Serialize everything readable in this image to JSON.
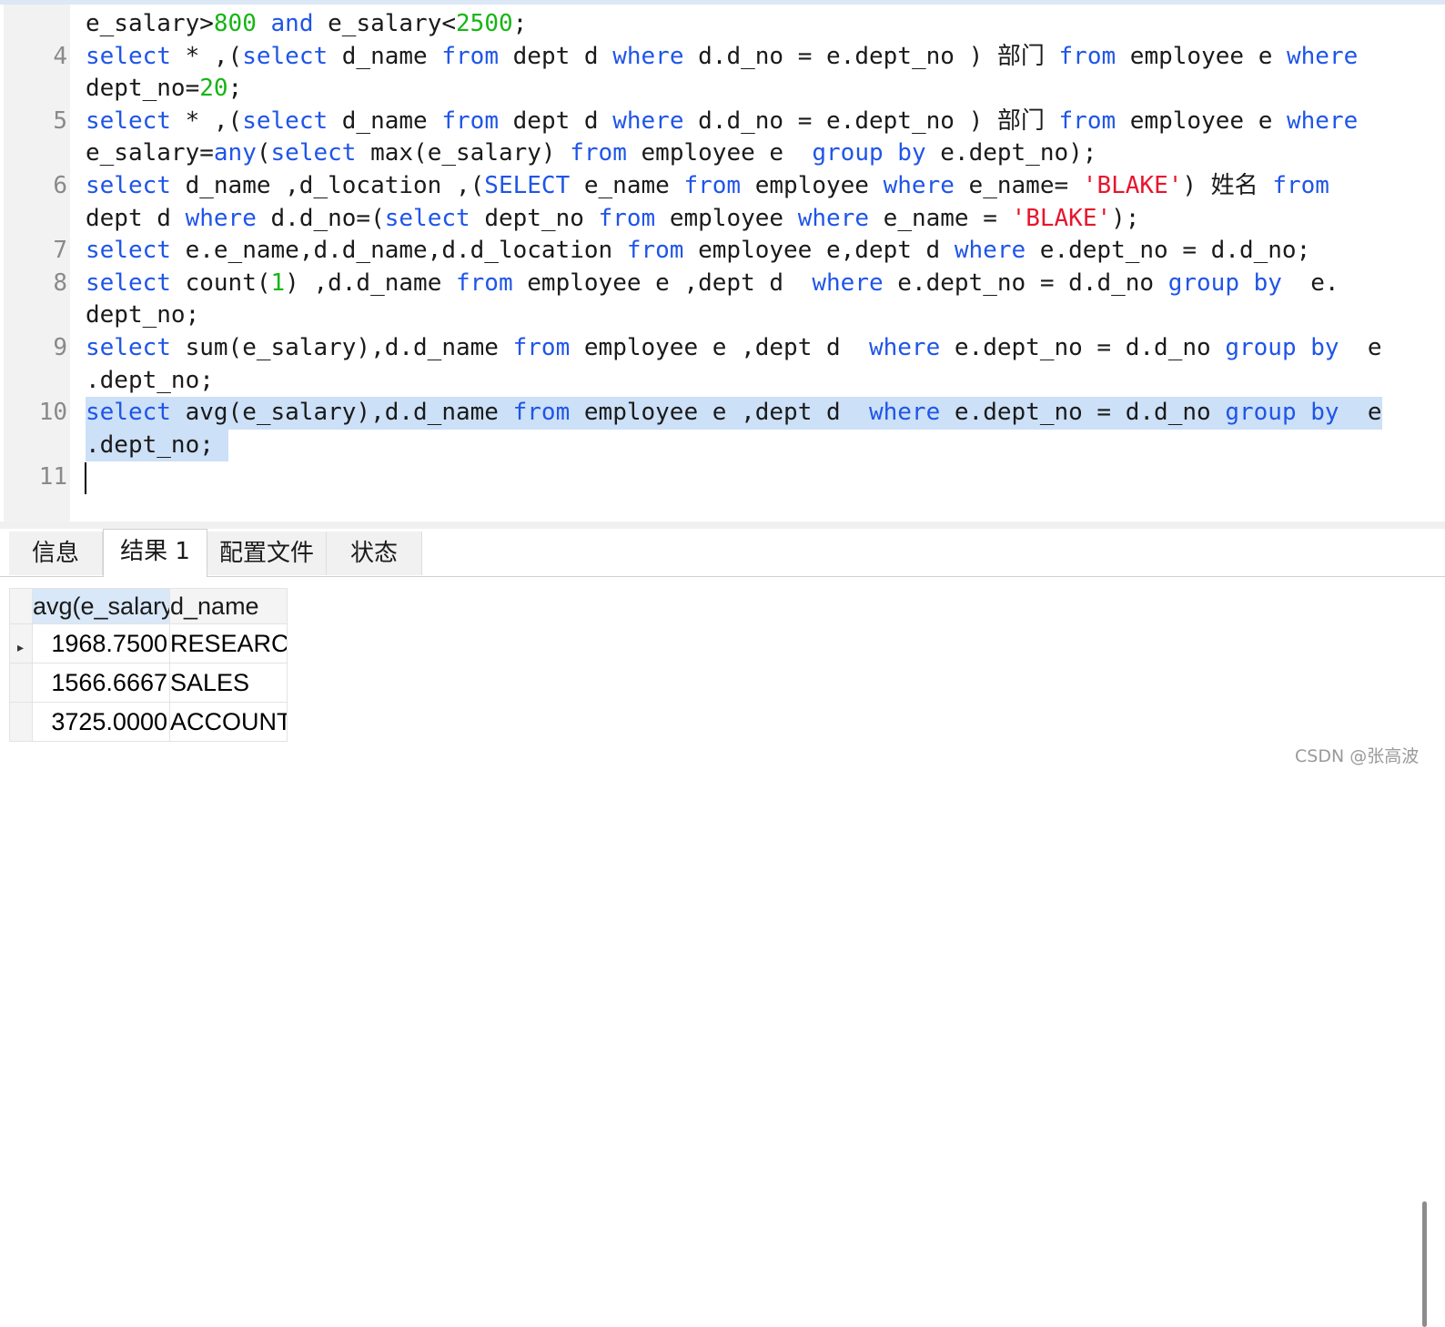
{
  "editor": {
    "colors": {
      "keyword": "#1f55e8",
      "number": "#15b515",
      "string": "#e8142c",
      "plain": "#1a1a1a",
      "line_number": "#8a8a8a",
      "selection": "#cce0f7"
    },
    "visual_lines": [
      {
        "num": "",
        "tokens": [
          [
            "e_salary>",
            "p"
          ],
          [
            "800",
            "n"
          ],
          [
            " ",
            "p"
          ],
          [
            "and",
            "k"
          ],
          [
            " e_salary<",
            "p"
          ],
          [
            "2500",
            "n"
          ],
          [
            ";",
            "p"
          ]
        ]
      },
      {
        "num": "4",
        "tokens": [
          [
            "select",
            "k"
          ],
          [
            " * ,(",
            "p"
          ],
          [
            "select",
            "k"
          ],
          [
            " d_name ",
            "p"
          ],
          [
            "from",
            "k"
          ],
          [
            " dept d ",
            "p"
          ],
          [
            "where",
            "k"
          ],
          [
            " d.d_no = e.dept_no ) 部门 ",
            "p"
          ],
          [
            "from",
            "k"
          ],
          [
            " employee e ",
            "p"
          ],
          [
            "where",
            "k"
          ]
        ]
      },
      {
        "num": "",
        "tokens": [
          [
            "dept_no=",
            "p"
          ],
          [
            "20",
            "n"
          ],
          [
            ";",
            "p"
          ]
        ]
      },
      {
        "num": "5",
        "tokens": [
          [
            "select",
            "k"
          ],
          [
            " * ,(",
            "p"
          ],
          [
            "select",
            "k"
          ],
          [
            " d_name ",
            "p"
          ],
          [
            "from",
            "k"
          ],
          [
            " dept d ",
            "p"
          ],
          [
            "where",
            "k"
          ],
          [
            " d.d_no = e.dept_no ) 部门 ",
            "p"
          ],
          [
            "from",
            "k"
          ],
          [
            " employee e ",
            "p"
          ],
          [
            "where",
            "k"
          ]
        ]
      },
      {
        "num": "",
        "tokens": [
          [
            "e_salary=",
            "p"
          ],
          [
            "any",
            "k"
          ],
          [
            "(",
            "p"
          ],
          [
            "select",
            "k"
          ],
          [
            " max(e_salary) ",
            "p"
          ],
          [
            "from",
            "k"
          ],
          [
            " employee e  ",
            "p"
          ],
          [
            "group by",
            "k"
          ],
          [
            " e.dept_no);",
            "p"
          ]
        ]
      },
      {
        "num": "6",
        "tokens": [
          [
            "select",
            "k"
          ],
          [
            " d_name ,d_location ,(",
            "p"
          ],
          [
            "SELECT",
            "k"
          ],
          [
            " e_name ",
            "p"
          ],
          [
            "from",
            "k"
          ],
          [
            " employee ",
            "p"
          ],
          [
            "where",
            "k"
          ],
          [
            " e_name= ",
            "p"
          ],
          [
            "'BLAKE'",
            "s"
          ],
          [
            ") 姓名 ",
            "p"
          ],
          [
            "from",
            "k"
          ]
        ]
      },
      {
        "num": "",
        "tokens": [
          [
            "dept d ",
            "p"
          ],
          [
            "where",
            "k"
          ],
          [
            " d.d_no=(",
            "p"
          ],
          [
            "select",
            "k"
          ],
          [
            " dept_no ",
            "p"
          ],
          [
            "from",
            "k"
          ],
          [
            " employee ",
            "p"
          ],
          [
            "where",
            "k"
          ],
          [
            " e_name = ",
            "p"
          ],
          [
            "'BLAKE'",
            "s"
          ],
          [
            ");",
            "p"
          ]
        ]
      },
      {
        "num": "7",
        "tokens": [
          [
            "select",
            "k"
          ],
          [
            " e.e_name,d.d_name,d.d_location ",
            "p"
          ],
          [
            "from",
            "k"
          ],
          [
            " employee e,dept d ",
            "p"
          ],
          [
            "where",
            "k"
          ],
          [
            " e.dept_no = d.d_no;",
            "p"
          ]
        ]
      },
      {
        "num": "8",
        "tokens": [
          [
            "select",
            "k"
          ],
          [
            " count(",
            "p"
          ],
          [
            "1",
            "n"
          ],
          [
            ") ,d.d_name ",
            "p"
          ],
          [
            "from",
            "k"
          ],
          [
            " employee e ,dept d  ",
            "p"
          ],
          [
            "where",
            "k"
          ],
          [
            " e.dept_no = d.d_no ",
            "p"
          ],
          [
            "group by",
            "k"
          ],
          [
            "  e.",
            "p"
          ]
        ]
      },
      {
        "num": "",
        "tokens": [
          [
            "dept_no;",
            "p"
          ]
        ]
      },
      {
        "num": "9",
        "tokens": [
          [
            "select",
            "k"
          ],
          [
            " sum(e_salary),d.d_name ",
            "p"
          ],
          [
            "from",
            "k"
          ],
          [
            " employee e ,dept d  ",
            "p"
          ],
          [
            "where",
            "k"
          ],
          [
            " e.dept_no = d.d_no ",
            "p"
          ],
          [
            "group by",
            "k"
          ],
          [
            "  e",
            "p"
          ]
        ]
      },
      {
        "num": "",
        "tokens": [
          [
            ".dept_no;",
            "p"
          ]
        ]
      },
      {
        "num": "10",
        "selected": true,
        "tokens": [
          [
            "select",
            "k"
          ],
          [
            " avg(e_salary),d.d_name ",
            "p"
          ],
          [
            "from",
            "k"
          ],
          [
            " employee e ,dept d  ",
            "p"
          ],
          [
            "where",
            "k"
          ],
          [
            " e.dept_no = d.d_no ",
            "p"
          ],
          [
            "group by",
            "k"
          ],
          [
            "  e",
            "p"
          ]
        ]
      },
      {
        "num": "",
        "selected": true,
        "tokens": [
          [
            ".dept_no; ",
            "p"
          ]
        ]
      },
      {
        "num": "11",
        "tokens": []
      }
    ]
  },
  "tabs": [
    {
      "label": "信息",
      "active": false
    },
    {
      "label": "结果 1",
      "active": true
    },
    {
      "label": "配置文件",
      "active": false
    },
    {
      "label": "状态",
      "active": false
    }
  ],
  "results": {
    "columns": [
      "avg(e_salary)",
      "d_name"
    ],
    "rows": [
      [
        "1968.7500",
        "RESEARCH"
      ],
      [
        "1566.6667",
        "SALES"
      ],
      [
        "3725.0000",
        "ACCOUNTING"
      ]
    ],
    "current_row_icon": "row-pointer-icon"
  },
  "watermark": "CSDN @张高波"
}
